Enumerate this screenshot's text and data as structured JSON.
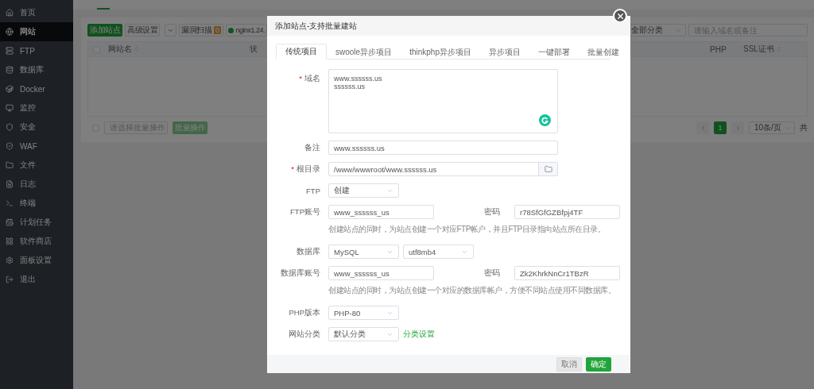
{
  "sidebar": {
    "items": [
      {
        "label": "首页",
        "selected": false
      },
      {
        "label": "网站",
        "selected": true
      },
      {
        "label": "FTP",
        "selected": false
      },
      {
        "label": "数据库",
        "selected": false
      },
      {
        "label": "Docker",
        "selected": false
      },
      {
        "label": "监控",
        "selected": false
      },
      {
        "label": "安全",
        "selected": false
      },
      {
        "label": "WAF",
        "selected": false
      },
      {
        "label": "文件",
        "selected": false
      },
      {
        "label": "日志",
        "selected": false
      },
      {
        "label": "终端",
        "selected": false
      },
      {
        "label": "计划任务",
        "selected": false
      },
      {
        "label": "软件商店",
        "selected": false
      },
      {
        "label": "面板设置",
        "selected": false
      },
      {
        "label": "退出",
        "selected": false
      }
    ]
  },
  "toolbar": {
    "add_button": "添加站点",
    "settings_button": "高级设置",
    "scan_button": "漏洞扫描",
    "scan_count": "0",
    "server_button": "nginx1.24.",
    "category_select": "全部分类",
    "search": {
      "placeholder": "请输入域名或备注"
    }
  },
  "table": {
    "select_all": {
      "checked": false
    },
    "columns": [
      {
        "label": "网站名",
        "sortable": true
      },
      {
        "label": "状",
        "sortable": false
      },
      {
        "label": "PHP",
        "sortable": false
      },
      {
        "label": "SSL证书",
        "sortable": true
      }
    ]
  },
  "batch": {
    "checked": false,
    "select_placeholder": "请选择批量操作",
    "button": "批量操作"
  },
  "pagination": {
    "pages": [
      {
        "label": "1",
        "selected": true
      }
    ],
    "page_size": "10条/页",
    "total": "共"
  },
  "dialog": {
    "title": "添加站点-支持批量建站",
    "required_mark": "*",
    "tabs": [
      {
        "label": "传统项目",
        "selected": true
      },
      {
        "label": "swoole异步项目",
        "selected": false
      },
      {
        "label": "thinkphp异步项目",
        "selected": false
      },
      {
        "label": "异步项目",
        "selected": false
      },
      {
        "label": "一键部署",
        "selected": false
      },
      {
        "label": "批量创建",
        "selected": false
      }
    ],
    "form": [
      {
        "kind": "textarea",
        "label": "域名",
        "required": true,
        "lines": [
          "www.ssssss.us",
          "ssssss.us"
        ]
      },
      {
        "kind": "input",
        "label": "备注",
        "required": false,
        "value": "www.ssssss.us"
      },
      {
        "kind": "path",
        "label": "根目录",
        "required": true,
        "value": "/www/wwwroot/www.ssssss.us"
      },
      {
        "kind": "select",
        "label": "FTP",
        "required": false,
        "value": "创建"
      },
      {
        "kind": "account",
        "label": "FTP账号",
        "required": false,
        "value": "www_ssssss_us",
        "password_label": "密码",
        "password": "r78SfGfGZBfpj4TF",
        "hint": "创建站点的同时，为站点创建一个对应FTP帐户，并且FTP目录指向站点所在目录。"
      },
      {
        "kind": "selects",
        "label": "数据库",
        "required": false,
        "values": [
          "MySQL",
          "utf8mb4"
        ]
      },
      {
        "kind": "account",
        "label": "数据库账号",
        "required": false,
        "value": "www_ssssss_us",
        "password_label": "密码",
        "password": "Zk2KhrkNnCr1TBzR",
        "hint": "创建站点的同时，为站点创建一个对应的数据库帐户，方便不同站点使用不同数据库。"
      },
      {
        "kind": "select",
        "label": "PHP版本",
        "required": false,
        "value": "PHP-80"
      },
      {
        "kind": "select",
        "label": "网站分类",
        "required": false,
        "value": "默认分类",
        "link": "分类设置"
      }
    ],
    "buttons": [
      {
        "label": "取消",
        "disabled": true
      },
      {
        "label": "确定",
        "disabled": false
      }
    ]
  }
}
